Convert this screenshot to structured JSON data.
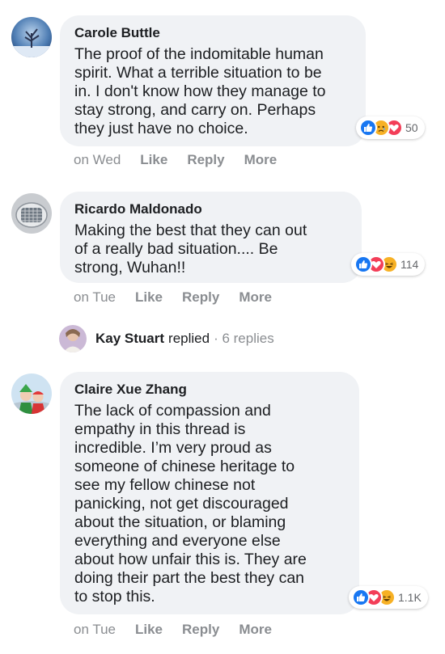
{
  "colors": {
    "bubble": "#f0f2f5",
    "like_blue": "#1877f2",
    "love_red": "#f33e58",
    "haha_yellow": "#f7b125",
    "muted_text": "#8a8d91"
  },
  "comments": [
    {
      "author": "Carole Buttle",
      "text": "The proof of the indomitable human\nspirit. What a terrible situation to be\nin. I don't know how they manage to\nstay strong, and carry on. Perhaps\nthey just have no choice.",
      "reaction_icons": [
        "like-icon",
        "sad-icon",
        "love-icon"
      ],
      "reaction_count": "50",
      "time": "on Wed",
      "actions": [
        "Like",
        "Reply",
        "More"
      ]
    },
    {
      "author": "Ricardo Maldonado",
      "text": "Making the best that they can out\nof a really bad situation.... Be\nstrong, Wuhan!!",
      "reaction_icons": [
        "like-icon",
        "love-icon",
        "haha-icon"
      ],
      "reaction_count": "114",
      "time": "on Tue",
      "actions": [
        "Like",
        "Reply",
        "More"
      ],
      "replies": {
        "name": "Kay Stuart",
        "verb": "replied",
        "count": "· 6 replies"
      }
    },
    {
      "author": "Claire Xue Zhang",
      "text": "The lack of compassion and\nempathy in this thread is\nincredible. I’m very proud as\nsomeone of chinese heritage to\nsee my fellow chinese not\npanicking, not get discouraged\nabout the situation, or blaming\neverything and everyone else\nabout how unfair this is. They are\ndoing their part the best they can\nto stop this.",
      "reaction_icons": [
        "like-icon",
        "love-icon",
        "haha-icon"
      ],
      "reaction_count": "1.1K",
      "time": "on Tue",
      "actions": [
        "Like",
        "Reply",
        "More"
      ]
    }
  ]
}
